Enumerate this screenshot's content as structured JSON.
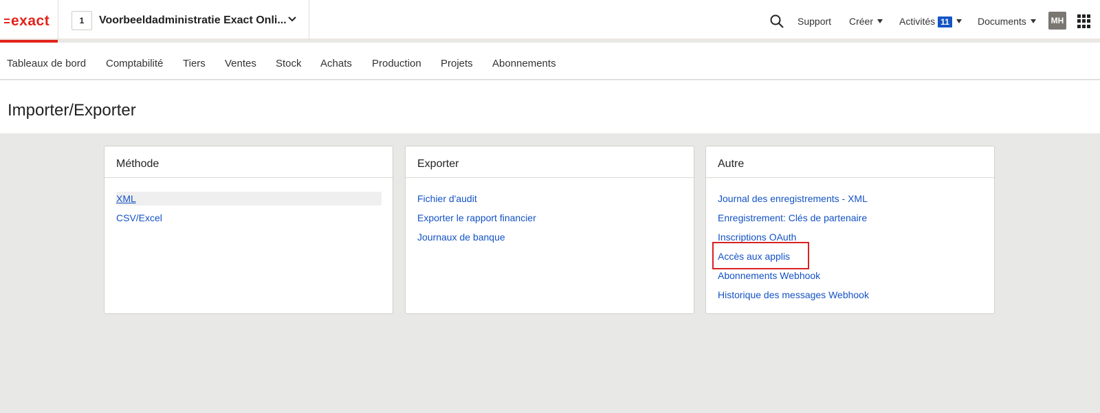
{
  "brand": {
    "name": "exact",
    "color": "#e2231a"
  },
  "topbar": {
    "company_number": "1",
    "company_name": "Voorbeeldadministratie Exact Onli...",
    "support": "Support",
    "create": "Créer",
    "activities": "Activités",
    "activities_count": "11",
    "documents": "Documents",
    "user_initials": "MH"
  },
  "nav": {
    "items": [
      "Tableaux de bord",
      "Comptabilité",
      "Tiers",
      "Ventes",
      "Stock",
      "Achats",
      "Production",
      "Projets",
      "Abonnements"
    ]
  },
  "page": {
    "title": "Importer/Exporter"
  },
  "cards": [
    {
      "title": "Méthode",
      "links": [
        "XML",
        "CSV/Excel"
      ],
      "active_index": 0
    },
    {
      "title": "Exporter",
      "links": [
        "Fichier d'audit",
        "Exporter le rapport financier",
        "Journaux de banque"
      ]
    },
    {
      "title": "Autre",
      "links": [
        "Journal des enregistrements - XML",
        "Enregistrement: Clés de partenaire",
        "Inscriptions OAuth",
        "Accès aux applis",
        "Abonnements Webhook",
        "Historique des messages Webhook"
      ],
      "highlighted_index": 3
    }
  ],
  "icons": {
    "search": "search-icon",
    "chevron": "chevron-down-icon",
    "apps": "app-grid-icon"
  },
  "colors": {
    "link": "#1352c6",
    "badge": "#1555c4",
    "highlight": "#d92020"
  }
}
